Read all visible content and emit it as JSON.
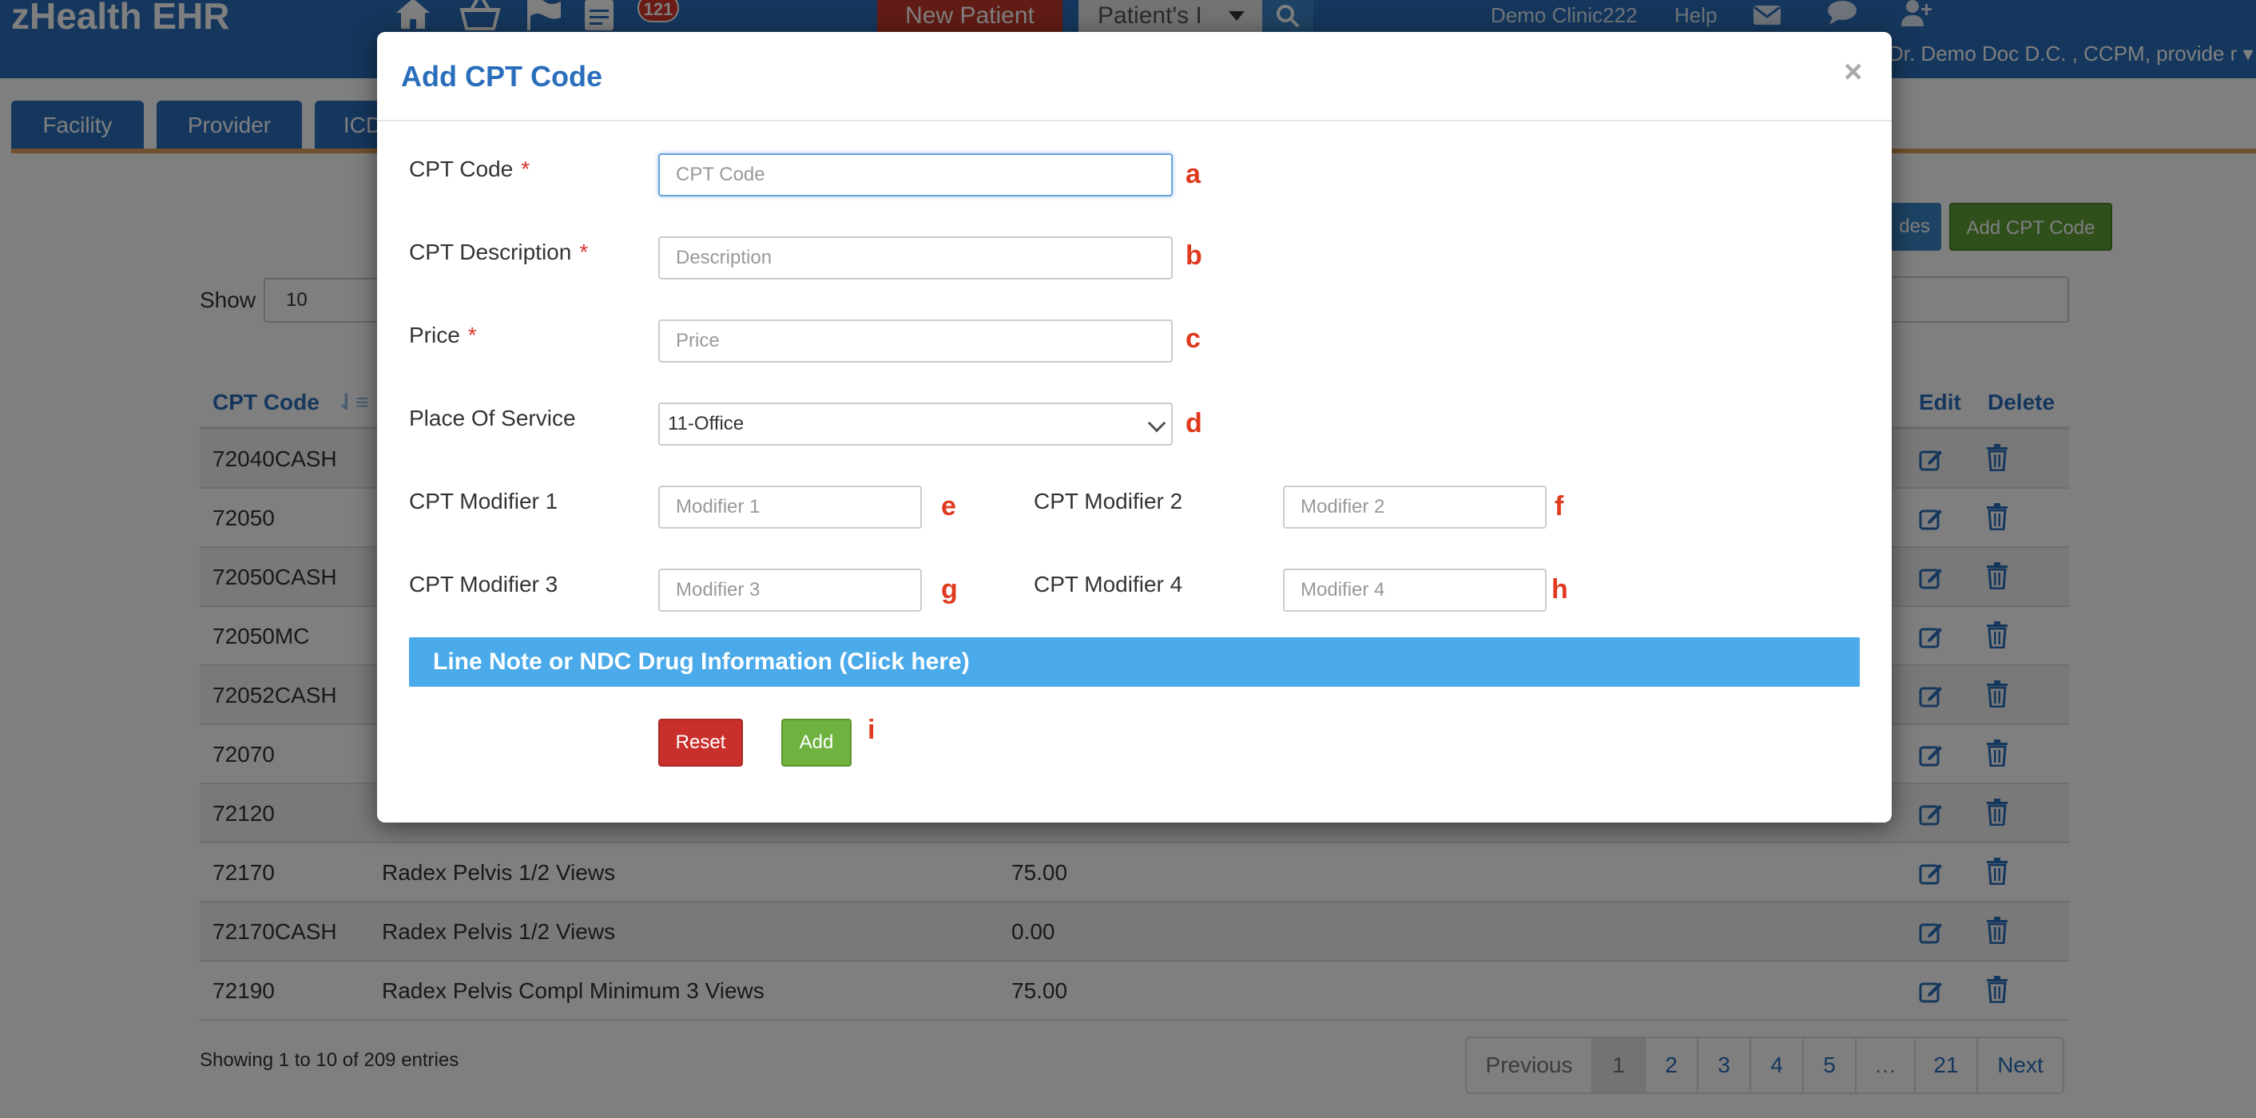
{
  "app": {
    "title": "zHealth EHR",
    "badge_count": "121"
  },
  "topbar": {
    "new_patient": "New Patient",
    "patient_select": "Patient's I",
    "clinic": "Demo Clinic222",
    "help": "Help",
    "user": "Dr. Demo Doc D.C. , CCPM, provide r"
  },
  "tabs": [
    {
      "label": "Facility"
    },
    {
      "label": "Provider"
    },
    {
      "label": "ICD"
    }
  ],
  "page": {
    "codes_button": "des",
    "add_cpt_button": "Add CPT Code",
    "show_label": "Show",
    "show_value": "10",
    "table": {
      "headers": {
        "code": "CPT Code",
        "edit": "Edit",
        "delete": "Delete"
      },
      "rows": [
        {
          "code": "72040CASH",
          "desc": "",
          "price": ""
        },
        {
          "code": "72050",
          "desc": "",
          "price": ""
        },
        {
          "code": "72050CASH",
          "desc": "",
          "price": ""
        },
        {
          "code": "72050MC",
          "desc": "",
          "price": ""
        },
        {
          "code": "72052CASH",
          "desc": "",
          "price": ""
        },
        {
          "code": "72070",
          "desc": "",
          "price": ""
        },
        {
          "code": "72120",
          "desc": "",
          "price": ""
        },
        {
          "code": "72170",
          "desc": "Radex Pelvis 1/2 Views",
          "price": "75.00"
        },
        {
          "code": "72170CASH",
          "desc": "Radex Pelvis 1/2 Views",
          "price": "0.00"
        },
        {
          "code": "72190",
          "desc": "Radex Pelvis Compl Minimum 3 Views",
          "price": "75.00"
        }
      ]
    },
    "showing": "Showing 1 to 10 of 209 entries",
    "pagination": [
      "Previous",
      "1",
      "2",
      "3",
      "4",
      "5",
      "…",
      "21",
      "Next"
    ]
  },
  "modal": {
    "title": "Add CPT Code",
    "close": "×",
    "fields": {
      "cpt_code": {
        "label": "CPT Code",
        "placeholder": "CPT Code",
        "annotation": "a"
      },
      "description": {
        "label": "CPT Description",
        "placeholder": "Description",
        "annotation": "b"
      },
      "price": {
        "label": "Price",
        "placeholder": "Price",
        "annotation": "c"
      },
      "place_of_service": {
        "label": "Place Of Service",
        "value": "11-Office",
        "annotation": "d"
      },
      "modifier1": {
        "label": "CPT Modifier 1",
        "placeholder": "Modifier 1",
        "annotation": "e"
      },
      "modifier2": {
        "label": "CPT Modifier 2",
        "placeholder": "Modifier 2",
        "annotation": "f"
      },
      "modifier3": {
        "label": "CPT Modifier 3",
        "placeholder": "Modifier 3",
        "annotation": "g"
      },
      "modifier4": {
        "label": "CPT Modifier 4",
        "placeholder": "Modifier 4",
        "annotation": "h"
      }
    },
    "required_mark": "*",
    "line_note": "Line Note or NDC Drug Information (Click here)",
    "reset": "Reset",
    "add": "Add",
    "add_annotation": "i"
  }
}
